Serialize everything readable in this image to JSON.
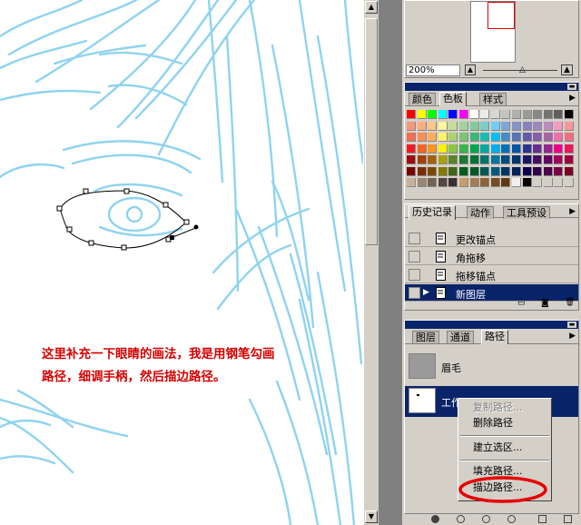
{
  "navigator": {
    "zoom": "200%"
  },
  "color_panel": {
    "tabs": [
      "颜色",
      "色板",
      "样式"
    ],
    "active": "色板"
  },
  "history_panel": {
    "tabs": [
      "历史记录",
      "动作",
      "工具预设"
    ],
    "items": [
      {
        "label": "更改锚点",
        "selected": false
      },
      {
        "label": "角拖移",
        "selected": false
      },
      {
        "label": "拖移锚点",
        "selected": false
      },
      {
        "label": "新图层",
        "selected": true
      }
    ]
  },
  "paths_panel": {
    "tabs": [
      "图层",
      "通道",
      "路径"
    ],
    "items": [
      {
        "label": "眉毛",
        "selected": false
      },
      {
        "label": "工作路径",
        "selected": true
      }
    ]
  },
  "context_menu": {
    "items": [
      {
        "label": "复制路径...",
        "enabled": false
      },
      {
        "label": "删除路径",
        "enabled": true
      },
      {
        "label": "建立选区...",
        "enabled": true
      },
      {
        "label": "填充路径...",
        "enabled": true
      },
      {
        "label": "描边路径...",
        "enabled": true,
        "highlighted": true
      }
    ]
  },
  "annotation": {
    "line1": "这里补充一下眼睛的画法，我是用钢笔勾画",
    "line2": "路径，细调手柄，然后描边路径。"
  },
  "colors": {
    "sketch": "#8fd3ef",
    "accent": "#e60000",
    "selection": "#0a246a",
    "chrome": "#d4d0c8"
  }
}
